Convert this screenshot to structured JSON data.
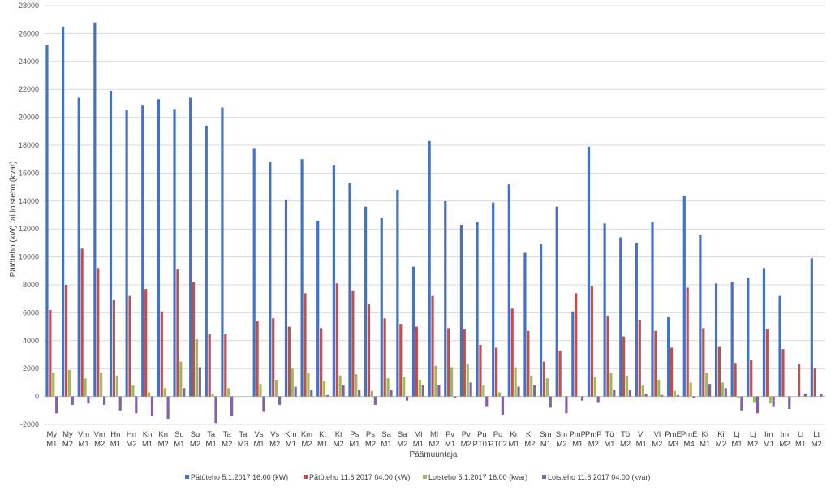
{
  "chart_data": {
    "type": "bar",
    "title": "",
    "xlabel": "Päämuuntaja",
    "ylabel": "Pätöteho (kW) tai loisteho (kvar)",
    "ylim": [
      -2000,
      28000
    ],
    "ytick_step": 2000,
    "grid": true,
    "legend_position": "bottom",
    "categories": [
      [
        "My",
        "M1"
      ],
      [
        "My",
        "M2"
      ],
      [
        "Vm",
        "M1"
      ],
      [
        "Vm",
        "M2"
      ],
      [
        "Hn",
        "M1"
      ],
      [
        "Hn",
        "M2"
      ],
      [
        "Kn",
        "M1"
      ],
      [
        "Kn",
        "M2"
      ],
      [
        "Su",
        "M1"
      ],
      [
        "Su",
        "M2"
      ],
      [
        "Ta",
        "M1"
      ],
      [
        "Ta",
        "M2"
      ],
      [
        "Ta",
        "M3"
      ],
      [
        "Vs",
        "M1"
      ],
      [
        "Vs",
        "M2"
      ],
      [
        "Km",
        "M1"
      ],
      [
        "Km",
        "M2"
      ],
      [
        "Kt",
        "M1"
      ],
      [
        "Kt",
        "M2"
      ],
      [
        "Ps",
        "M1"
      ],
      [
        "Ps",
        "M2"
      ],
      [
        "Sa",
        "M1"
      ],
      [
        "Sa",
        "M2"
      ],
      [
        "Ml",
        "M1"
      ],
      [
        "Ml",
        "M2"
      ],
      [
        "Pv",
        "M1"
      ],
      [
        "Pv",
        "M2"
      ],
      [
        "Pu",
        "PT01"
      ],
      [
        "Pu",
        "PT02"
      ],
      [
        "Kr",
        "M1"
      ],
      [
        "Kr",
        "M2"
      ],
      [
        "Sm",
        "M1"
      ],
      [
        "Sm",
        "M2"
      ],
      [
        "PmP",
        "M1"
      ],
      [
        "PmP",
        "M2"
      ],
      [
        "Tö",
        "M1"
      ],
      [
        "Tö",
        "M2"
      ],
      [
        "Vl",
        "M1"
      ],
      [
        "Vl",
        "M2"
      ],
      [
        "PmE",
        "M3"
      ],
      [
        "PmE",
        "M4"
      ],
      [
        "Ki",
        "M1"
      ],
      [
        "Ki",
        "M2"
      ],
      [
        "Lj",
        "M1"
      ],
      [
        "Lj",
        "M2"
      ],
      [
        "Im",
        "M1"
      ],
      [
        "Im",
        "M2"
      ],
      [
        "Lt",
        "M1"
      ],
      [
        "Lt",
        "M2"
      ]
    ],
    "series": [
      {
        "name": "Pätöteho 5.1.2017 16:00 (kW)",
        "color": "#4472C4",
        "values": [
          25200,
          26500,
          21400,
          26800,
          21900,
          20500,
          20900,
          21300,
          20600,
          21400,
          19400,
          20700,
          0,
          17800,
          16800,
          14100,
          17000,
          12600,
          16600,
          15300,
          13600,
          12800,
          14800,
          9300,
          18300,
          14000,
          12300,
          12500,
          13900,
          15200,
          10300,
          10900,
          13600,
          6100,
          17900,
          12400,
          11400,
          11000,
          12500,
          5700,
          14400,
          11600,
          8100,
          8200,
          8500,
          9200,
          7200,
          0,
          9900
        ]
      },
      {
        "name": "Pätöteho 11.6.2017 04:00 (kW)",
        "color": "#C0504D",
        "values": [
          6200,
          8000,
          10600,
          9200,
          6900,
          7200,
          7700,
          6100,
          9100,
          8200,
          4500,
          4500,
          0,
          5400,
          5600,
          5000,
          7400,
          4900,
          8100,
          7600,
          6600,
          5600,
          5200,
          5000,
          7200,
          4900,
          4800,
          3700,
          3500,
          6300,
          4700,
          2500,
          3300,
          7400,
          7900,
          5800,
          4300,
          5500,
          4700,
          3500,
          7800,
          4900,
          3600,
          2400,
          2600,
          4800,
          3400,
          2300,
          2000
        ]
      },
      {
        "name": "Loisteho 5.1.2017 16:00 (kvar)",
        "color": "#9BBB59",
        "values": [
          1700,
          1900,
          1300,
          1700,
          1500,
          800,
          300,
          600,
          2500,
          4100,
          200,
          600,
          0,
          900,
          1200,
          2000,
          1700,
          1100,
          1500,
          1600,
          400,
          1300,
          1400,
          1200,
          2200,
          2100,
          2300,
          800,
          300,
          2100,
          1500,
          1300,
          0,
          0,
          1400,
          1700,
          1500,
          800,
          1200,
          400,
          1000,
          1700,
          1000,
          -100,
          -400,
          -500,
          0,
          0,
          0
        ]
      },
      {
        "name": "Loisteho 11.6.2017 04:00 (kvar)",
        "color": "#8064A2",
        "values": [
          -1200,
          -600,
          -500,
          -600,
          -1000,
          -1200,
          -1400,
          -1600,
          600,
          2100,
          -1900,
          -1400,
          0,
          -1100,
          -600,
          700,
          500,
          100,
          800,
          500,
          -600,
          500,
          -300,
          800,
          800,
          -100,
          1000,
          -700,
          -1300,
          700,
          800,
          -800,
          -1200,
          -300,
          -400,
          500,
          500,
          200,
          100,
          100,
          -100,
          900,
          600,
          -1000,
          -1200,
          -700,
          -900,
          200,
          200
        ]
      }
    ]
  }
}
